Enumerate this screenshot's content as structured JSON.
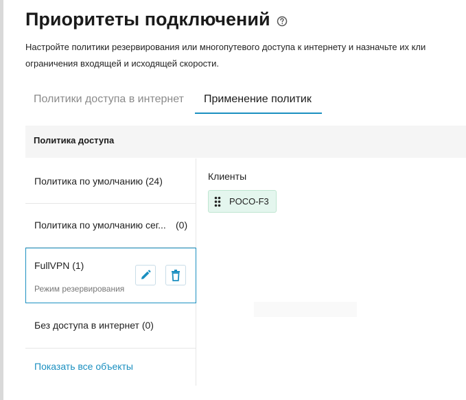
{
  "page": {
    "title": "Приоритеты подключений",
    "help_icon": "question-circle-icon",
    "description_line1": "Настройте политики резервирования или многопутевого доступа к интернету и назначьте их кли",
    "description_line2": "ограничения входящей и исходящей скорости."
  },
  "tabs": [
    {
      "label": "Политики доступа в интернет",
      "active": false
    },
    {
      "label": "Применение политик",
      "active": true
    }
  ],
  "table": {
    "header": "Политика доступа"
  },
  "policies": [
    {
      "label": "Политика по умолчанию (24)"
    },
    {
      "label": "Политика по умолчанию сег...",
      "count": "(0)"
    },
    {
      "label": "FullVPN (1)",
      "subtitle": "Режим резервирования",
      "selected": true,
      "edit_icon": "pencil-icon",
      "delete_icon": "trash-icon"
    },
    {
      "label": "Без доступа в интернет (0)"
    }
  ],
  "show_all": "Показать все объекты",
  "clients": {
    "title": "Клиенты",
    "items": [
      {
        "label": "POCO-F3",
        "icon": "drag-handle-icon"
      }
    ]
  },
  "colors": {
    "accent": "#1a8fc0",
    "chip_bg": "#e4f6ee",
    "header_bg": "#f5f5f5"
  }
}
